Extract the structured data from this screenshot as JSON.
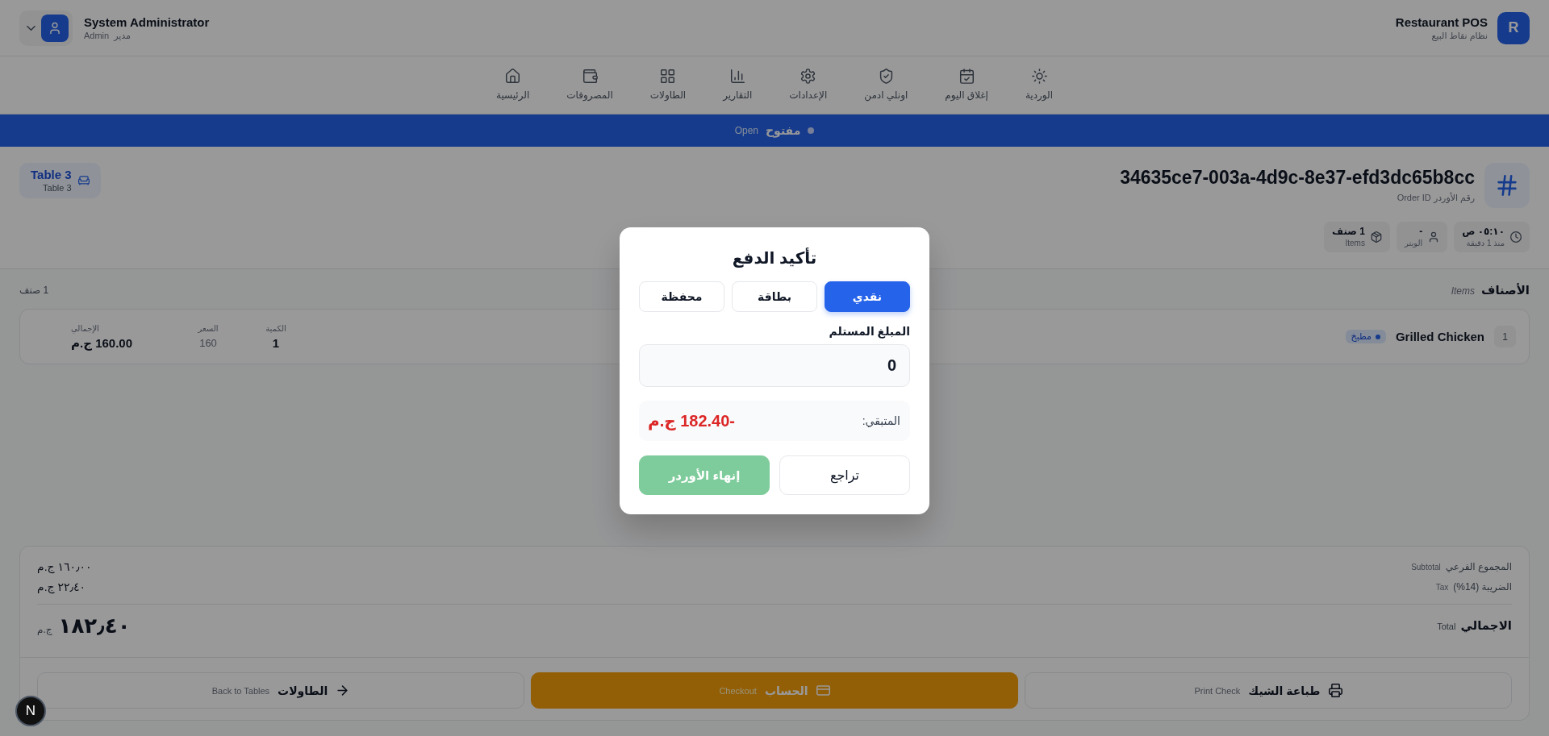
{
  "header": {
    "logo": "R",
    "app_name": "Restaurant POS",
    "app_subtitle": "نظام نقاط البيع",
    "user": {
      "name": "System Administrator",
      "role_ar": "مدير",
      "role_en": "Admin"
    }
  },
  "nav": [
    {
      "label": "الوردية"
    },
    {
      "label": "إغلاق اليوم"
    },
    {
      "label": "اونلي ادمن"
    },
    {
      "label": "الإعدادات"
    },
    {
      "label": "التقارير"
    },
    {
      "label": "الطاولات"
    },
    {
      "label": "المصروفات"
    },
    {
      "label": "الرئيسية"
    }
  ],
  "status_banner": {
    "label_ar": "مفتوح",
    "label_en": "Open"
  },
  "order": {
    "id": "34635ce7-003a-4d9c-8e37-efd3dc65b8cc",
    "id_label": "رقم الأوردر Order ID",
    "table": {
      "name": "Table 3",
      "subtitle": "Table 3"
    },
    "chips": [
      {
        "value": "٠٥:١٠ ص",
        "caption": "منذ 1 دقيقة"
      },
      {
        "value": "-",
        "caption": "الويتر"
      },
      {
        "value": "1 صنف",
        "caption": "Items"
      }
    ]
  },
  "items": {
    "title_ar": "الأصناف",
    "title_en": "Items",
    "count": "1 صنف",
    "rows": [
      {
        "number": "1",
        "name": "Grilled Chicken",
        "station": "مطبخ",
        "qty_label": "الكمية",
        "qty": "1",
        "price_label": "السعر",
        "price": "160",
        "total_label": "الإجمالي",
        "total": "160.00 ج.م"
      }
    ]
  },
  "summary": {
    "rows": [
      {
        "label_ar": "المجموع الفرعي",
        "label_en": "Subtotal",
        "value": "١٦٠٫٠٠ ج.م"
      },
      {
        "label_ar": "الضريبة (14%)",
        "label_en": "Tax",
        "value": "٢٢٫٤٠ ج.م"
      }
    ],
    "total": {
      "label_ar": "الاجمالي",
      "label_en": "Total",
      "value": "١٨٢٫٤٠",
      "currency": "ج.م"
    }
  },
  "actions": [
    {
      "kind": "print",
      "label_ar": "طباعة الشيك",
      "label_en": "Print Check"
    },
    {
      "kind": "checkout",
      "label_ar": "الحساب",
      "label_en": "Checkout"
    },
    {
      "kind": "back",
      "label_ar": "الطاولات",
      "label_en": "Back to Tables"
    }
  ],
  "payment_dialog": {
    "title": "تأكيد الدفع",
    "methods": [
      {
        "label": "نقدي",
        "selected": true
      },
      {
        "label": "بطاقة",
        "selected": false
      },
      {
        "label": "محفظة",
        "selected": false
      }
    ],
    "amount_label": "المبلغ المستلم",
    "amount_value": "0",
    "remaining_label": "المتبقي:",
    "remaining_value": "-182.40 ج.م",
    "buttons": [
      {
        "kind": "cancel",
        "label": "تراجع",
        "disabled": false
      },
      {
        "kind": "confirm",
        "label": "إنهاء الأوردر",
        "disabled": true
      }
    ]
  },
  "dev_indicator": {
    "label": "N"
  }
}
